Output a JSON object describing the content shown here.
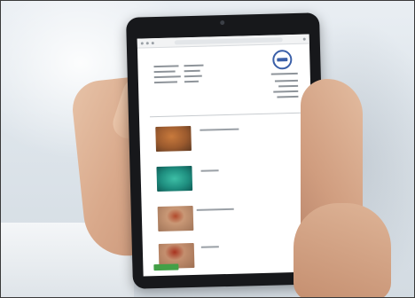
{
  "photo": {
    "subject": "hands-holding-tablet",
    "colors": {
      "background": "#dfe6ec",
      "tablet_body": "#17181b",
      "logo_blue": "#3a5fa8",
      "green_button": "#43a047",
      "red_button": "#e53935"
    }
  }
}
